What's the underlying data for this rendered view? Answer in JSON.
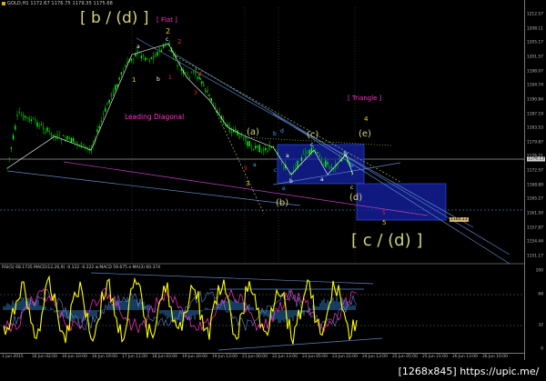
{
  "window": {
    "title": "GOLD,H1  1172.67 1176.75 1179.35 1175.68"
  },
  "price_axis": {
    "ticks": [
      "1212.57",
      "1208.11",
      "1205.17",
      "1201.57",
      "1198.07",
      "1194.74",
      "1190.84",
      "1187.19",
      "1183.53",
      "1179.87",
      "1176.21",
      "1172.57",
      "1168.89",
      "1165.27",
      "1161.50",
      "1157.87",
      "1154.44",
      "1151.17"
    ],
    "current_price": "1176.13",
    "marker_price": "1160.13"
  },
  "indicator_axis": {
    "ticks": [
      "100",
      "68",
      "32",
      "0"
    ]
  },
  "indicator": {
    "label": "RSI(5) 68.1735  MACD(12,26,9) -0.122  -0.222  w.MACD 59.675  e.MA(3) 60.374"
  },
  "time_axis": {
    "ticks": [
      "1 Jun 2015",
      "16 Jun 02:00",
      "16 Jun 10:00",
      "16 Jun 19:00",
      "17 Jun 11:00",
      "18 Jun 03:00",
      "19 Jun 20:00",
      "19 Jun 13:00",
      "21 Jun 00:00",
      "22 Jun 13:00",
      "23 Jun 05:00",
      "23 Jun 21:00",
      "24 Jun 13:00",
      "25 Jun 05:00",
      "25 Jun 21:00",
      "26 Jun 13:00",
      "26 Jun 10:00"
    ]
  },
  "annotations": {
    "wave_b_d": "[ b / (d) ]",
    "flat": "[ Flat ]",
    "wave_c_d": "[ c / (d) ]",
    "triangle": "[ Triangle ]",
    "leading_diagonal": "Leading Diagonal",
    "w_a": "(a)",
    "w_b": "(b)",
    "w_c": "(c)",
    "w_d": "(d)",
    "w_e": "(e)",
    "n_a": "a",
    "n_b": "b",
    "n_c": "c",
    "n_d": "d",
    "n_e": "e",
    "n_1": "1",
    "n_2": "2",
    "n_3": "3",
    "n_4": "4",
    "n_5": "5"
  },
  "watermark": "[1268x845] https://upic.me/",
  "colors": {
    "bull": "#00e000",
    "bear": "#00e000",
    "wave_yellow": "#f5d300",
    "wave_khaki": "#d2d07a",
    "wave_magenta": "#ff33cc",
    "wave_red": "#ff2020",
    "wave_blue": "#33aaff",
    "wave_white": "#ffffff",
    "box": "#1d25b8",
    "rsi": "#ffff00"
  }
}
